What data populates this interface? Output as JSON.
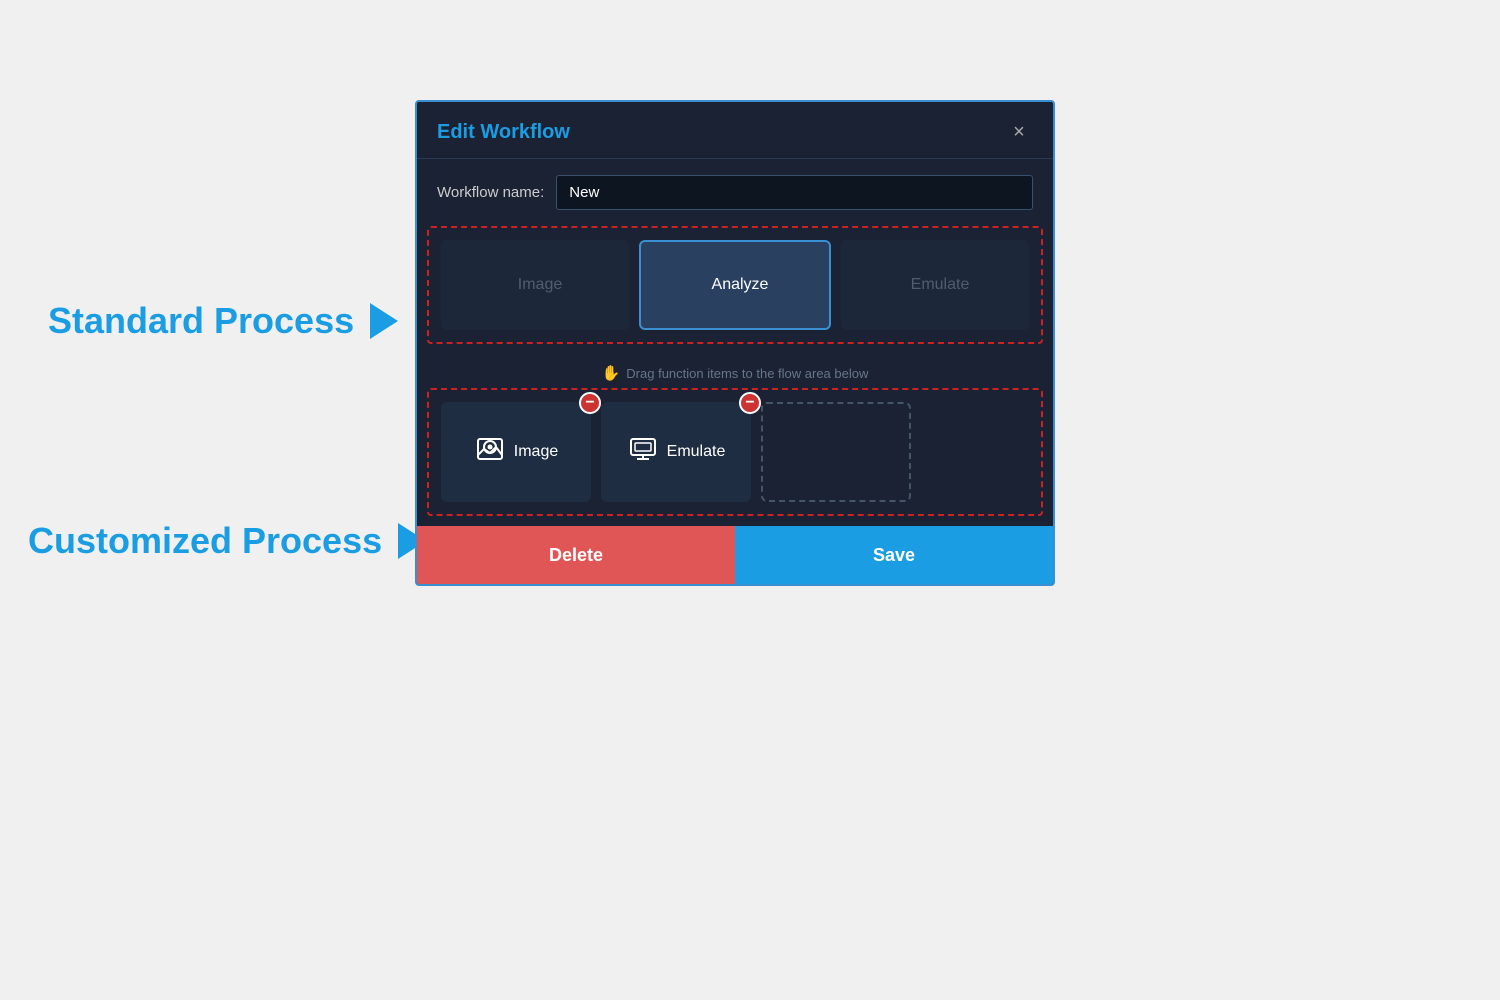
{
  "background": {
    "color": "#f0f0f0"
  },
  "side_labels": {
    "standard_process": {
      "text": "Standard Process",
      "arrow": "▶"
    },
    "customized_process": {
      "text": "Customized Process",
      "arrow": "▶"
    }
  },
  "modal": {
    "title": "Edit Workflow",
    "close_label": "×",
    "workflow_name_label": "Workflow name:",
    "workflow_name_value": "New",
    "drag_hint": "Drag function items to the flow area below",
    "standard_items": [
      {
        "id": "image",
        "label": "Image",
        "icon": "image-icon",
        "active": false
      },
      {
        "id": "analyze",
        "label": "Analyze",
        "icon": "analyze-icon",
        "active": true
      },
      {
        "id": "emulate",
        "label": "Emulate",
        "icon": "emulate-icon",
        "active": false
      }
    ],
    "flow_items": [
      {
        "id": "image",
        "label": "Image",
        "icon": "image-icon"
      },
      {
        "id": "emulate",
        "label": "Emulate",
        "icon": "emulate-icon"
      }
    ],
    "footer": {
      "delete_label": "Delete",
      "save_label": "Save"
    }
  }
}
